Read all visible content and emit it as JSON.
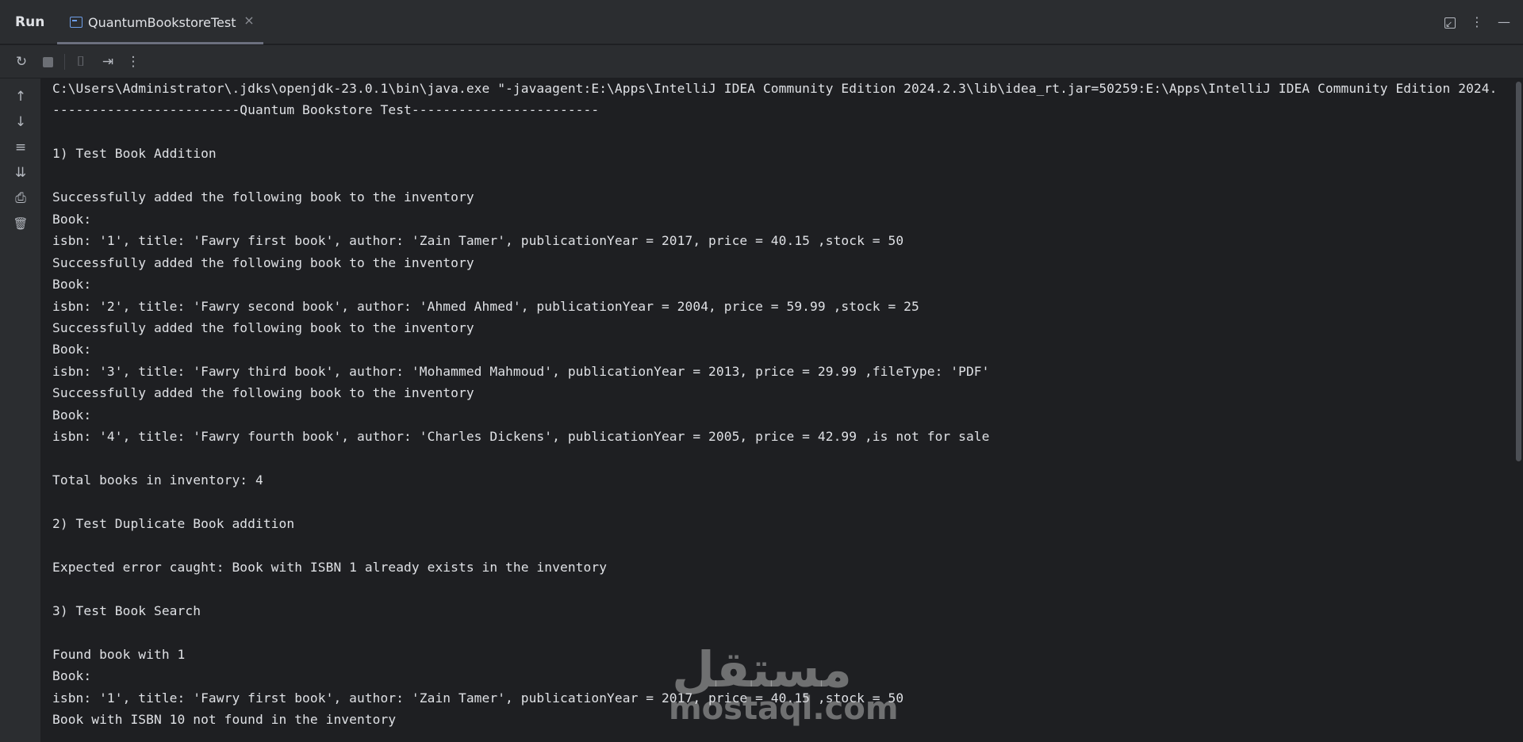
{
  "header": {
    "title": "Run",
    "tab": {
      "label": "QuantumBookstoreTest",
      "close": "×"
    },
    "more": "⋮",
    "minimize": "—"
  },
  "toolbar": {
    "rerun": "↻",
    "camera": "⌷",
    "exit": "⇥",
    "more": "⋮"
  },
  "gutter": {
    "up": "↑",
    "down": "↓",
    "wrap": "≡",
    "scroll_end": "⇊",
    "print": "⎙",
    "trash": "🗑"
  },
  "console": {
    "lines": [
      "C:\\Users\\Administrator\\.jdks\\openjdk-23.0.1\\bin\\java.exe \"-javaagent:E:\\Apps\\IntelliJ IDEA Community Edition 2024.2.3\\lib\\idea_rt.jar=50259:E:\\Apps\\IntelliJ IDEA Community Edition 2024.",
      "------------------------Quantum Bookstore Test------------------------",
      "",
      "1) Test Book Addition",
      "",
      "Successfully added the following book to the inventory",
      "Book:",
      "isbn: '1', title: 'Fawry first book', author: 'Zain Tamer', publicationYear = 2017, price = 40.15 ,stock = 50",
      "Successfully added the following book to the inventory",
      "Book:",
      "isbn: '2', title: 'Fawry second book', author: 'Ahmed Ahmed', publicationYear = 2004, price = 59.99 ,stock = 25",
      "Successfully added the following book to the inventory",
      "Book:",
      "isbn: '3', title: 'Fawry third book', author: 'Mohammed Mahmoud', publicationYear = 2013, price = 29.99 ,fileType: 'PDF'",
      "Successfully added the following book to the inventory",
      "Book:",
      "isbn: '4', title: 'Fawry fourth book', author: 'Charles Dickens', publicationYear = 2005, price = 42.99 ,is not for sale",
      "",
      "Total books in inventory: 4",
      "",
      "2) Test Duplicate Book addition",
      "",
      "Expected error caught: Book with ISBN 1 already exists in the inventory",
      "",
      "3) Test Book Search",
      "",
      "Found book with 1",
      "Book:",
      "isbn: '1', title: 'Fawry first book', author: 'Zain Tamer', publicationYear = 2017, price = 40.15 ,stock = 50",
      "Book with ISBN 10 not found in the inventory"
    ]
  },
  "watermark": {
    "arabic": "مستقل",
    "latin": "mostaql.com"
  }
}
